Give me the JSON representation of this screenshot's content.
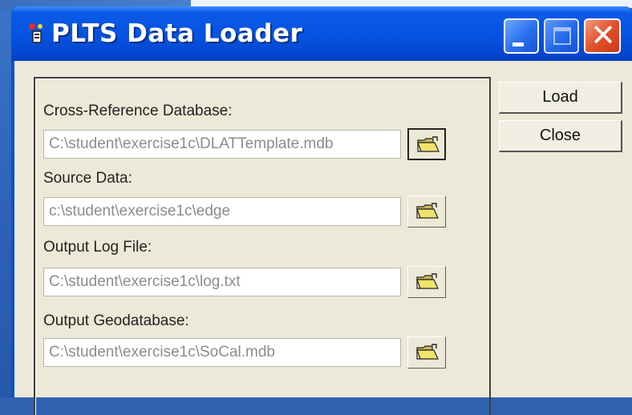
{
  "window": {
    "title": "PLTS Data Loader",
    "buttons": {
      "minimize": "minimize",
      "maximize": "maximize",
      "close": "✕"
    }
  },
  "form": {
    "cross_reference": {
      "label": "Cross-Reference Database:",
      "value": "C:\\student\\exercise1c\\DLATTemplate.mdb"
    },
    "source_data": {
      "label": "Source Data:",
      "value": "c:\\student\\exercise1c\\edge"
    },
    "output_log": {
      "label": "Output Log File:",
      "value": "C:\\student\\exercise1c\\log.txt"
    },
    "output_gdb": {
      "label": "Output Geodatabase:",
      "value": "C:\\student\\exercise1c\\SoCal.mdb"
    }
  },
  "actions": {
    "load": "Load",
    "close": "Close"
  },
  "icons": {
    "app": "app-icon",
    "browse": "open-folder-icon"
  },
  "colors": {
    "titlebar": "#0553e2",
    "client": "#ece9d8",
    "close_button": "#e2512b"
  }
}
